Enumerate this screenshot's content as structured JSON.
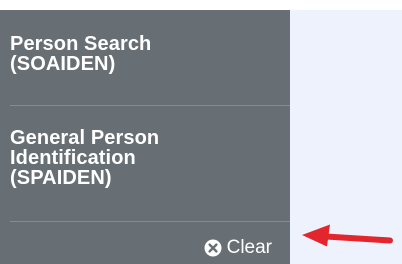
{
  "sidebar": {
    "items": [
      {
        "lines": [
          "Person Search",
          "(SOAIDEN)"
        ]
      },
      {
        "lines": [
          "General Person",
          "Identification",
          "(SPAIDEN)"
        ]
      }
    ],
    "clear_label": "Clear",
    "clear_icon": "times-circle-icon"
  },
  "annotation": {
    "arrow_icon": "red-arrow-left-icon",
    "arrow_color": "#e3262e"
  },
  "colors": {
    "panel_background": "#676e74",
    "right_background": "#eef2fc",
    "text": "#ffffff"
  }
}
